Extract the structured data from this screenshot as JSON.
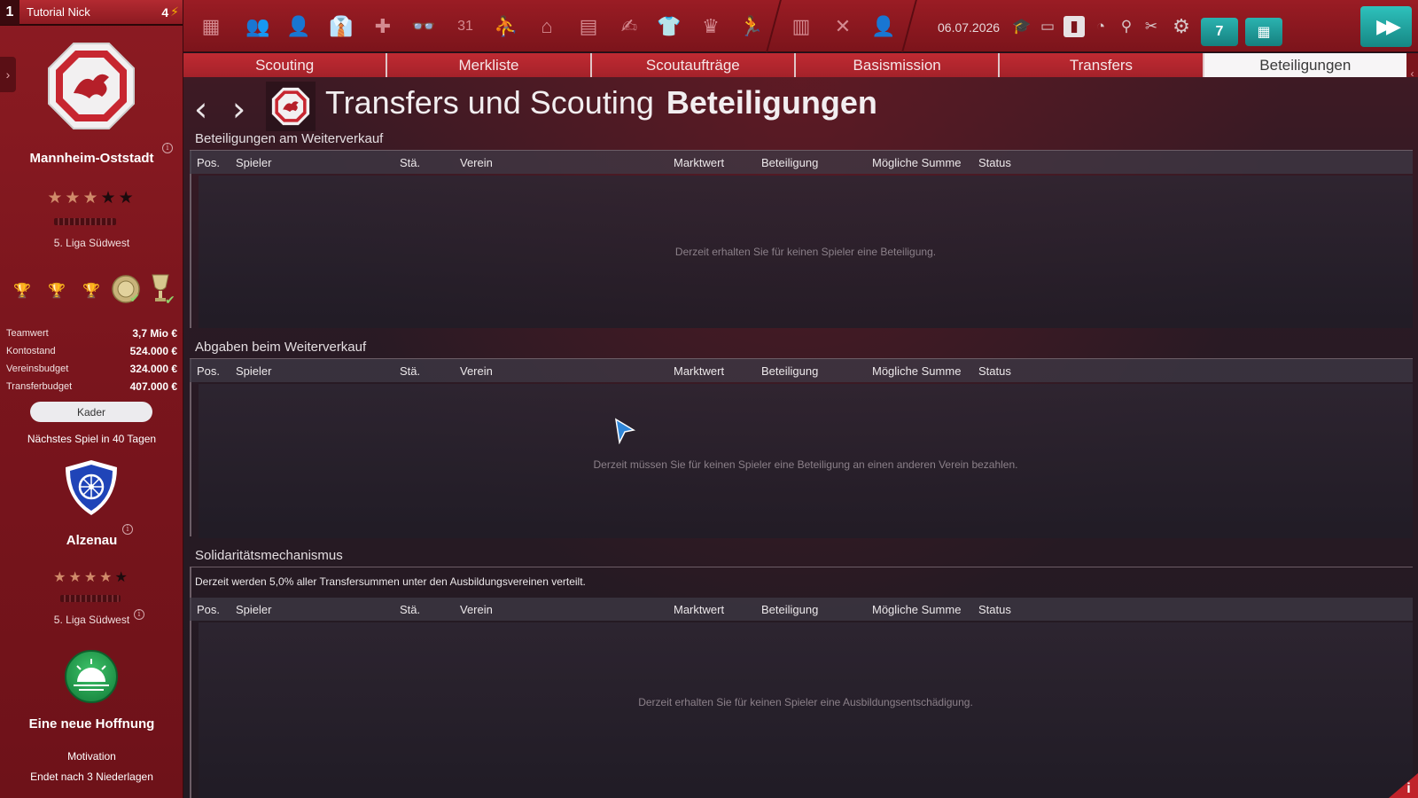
{
  "sidebar": {
    "rank": "1",
    "manager_name": "Tutorial Nick",
    "energy_count": "4",
    "club": {
      "name": "Mannheim-Oststadt",
      "stars_on": 3,
      "stars_total": 5,
      "league": "5. Liga Südwest"
    },
    "finances": [
      {
        "label": "Teamwert",
        "value": "3,7 Mio €"
      },
      {
        "label": "Kontostand",
        "value": "524.000 €"
      },
      {
        "label": "Vereinsbudget",
        "value": "324.000 €"
      },
      {
        "label": "Transferbudget",
        "value": "407.000 €"
      }
    ],
    "kader_button": "Kader",
    "next_game": "Nächstes Spiel in 40 Tagen",
    "opponent": {
      "name": "Alzenau",
      "stars_on": 4,
      "stars_total": 5,
      "league": "5. Liga Südwest"
    },
    "mission": {
      "title": "Eine neue Hoffnung",
      "label": "Motivation",
      "condition": "Endet nach 3 Niederlagen"
    }
  },
  "toolbar": {
    "date": "06.07.2026",
    "calendar_day": "7"
  },
  "tabs": [
    "Scouting",
    "Merkliste",
    "Scoutaufträge",
    "Basismission",
    "Transfers",
    "Beteiligungen"
  ],
  "active_tab": "Beteiligungen",
  "page": {
    "title_prefix": "Transfers und Scouting",
    "title_main": "Beteiligungen"
  },
  "columns": [
    "Pos.",
    "Spieler",
    "Stä.",
    "Verein",
    "Marktwert",
    "Beteiligung",
    "Mögliche Summe",
    "Status"
  ],
  "sections": [
    {
      "title": "Beteiligungen am Weiterverkauf",
      "empty": "Derzeit erhalten Sie für keinen Spieler eine Beteiligung."
    },
    {
      "title": "Abgaben beim Weiterverkauf",
      "empty": "Derzeit müssen Sie für keinen Spieler eine Beteiligung an einen anderen Verein bezahlen."
    },
    {
      "title": "Solidaritätsmechanismus",
      "note": "Derzeit werden 5,0% aller Transfersummen unter den Ausbildungsvereinen verteilt.",
      "empty": "Derzeit erhalten Sie für keinen Spieler eine Ausbildungsentschädigung."
    }
  ],
  "icons": [
    "formation-icon",
    "squad-icon",
    "players-icon",
    "staff-icon",
    "medical-icon",
    "scouting-icon",
    "calendar-icon",
    "training-icon",
    "stadium-icon",
    "finances-icon",
    "sponsor-icon",
    "jersey-icon",
    "board-icon",
    "youth-icon",
    "city-icon",
    "tactics-icon",
    "profile-icon"
  ],
  "colors": {
    "brand_red": "#9a1c24",
    "accent_teal": "#1f9e9b",
    "active_tab_bg": "#f7f5f6"
  }
}
